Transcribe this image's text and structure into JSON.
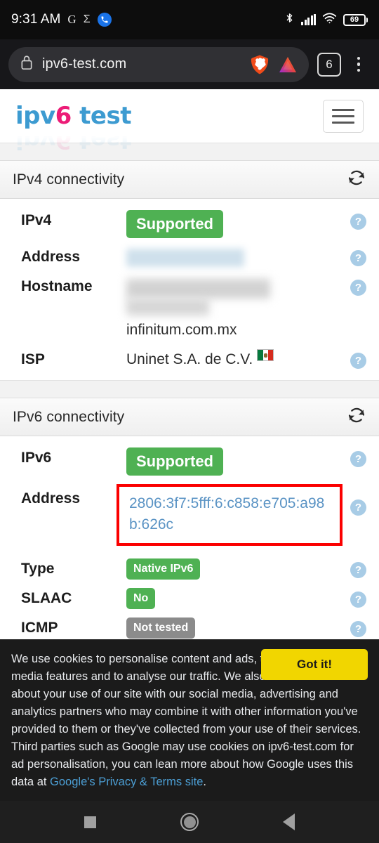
{
  "statusbar": {
    "time": "9:31 AM",
    "icons_left": [
      "google-g-icon",
      "sigma-icon",
      "phone-icon"
    ],
    "g_label": "G",
    "sigma_label": "Σ",
    "icons_right": [
      "bluetooth-icon",
      "cell-signal-icon",
      "wifi-icon",
      "battery-icon"
    ],
    "battery_percent": "69"
  },
  "browser": {
    "name": "Brave",
    "url": "ipv6-test.com",
    "lock_icon": "lock-icon",
    "shield_icon": "brave-lion-icon",
    "rewards_icon": "brave-triangle-icon",
    "tab_count": "6",
    "menu_icon": "kebab-menu-icon"
  },
  "site": {
    "logo_part1": "ipv",
    "logo_six": "6",
    "logo_part2": " test",
    "menu_button": "hamburger-menu"
  },
  "sections": [
    {
      "title": "IPv4 connectivity",
      "refresh_icon": "refresh-icon",
      "rows": [
        {
          "label": "IPv4",
          "kind": "badge",
          "badge_text": "Supported",
          "badge_color": "#4fb153",
          "badge_size": "big",
          "help": "?"
        },
        {
          "label": "Address",
          "kind": "redacted-blue",
          "help": "?"
        },
        {
          "label": "Hostname",
          "kind": "redacted-gray",
          "sub_text": "infinitum.com.mx",
          "help": "?"
        },
        {
          "label": "ISP",
          "kind": "text-flag",
          "value": "Uninet S.A. de C.V.",
          "flag": "mexico-flag",
          "help": "?"
        }
      ]
    },
    {
      "title": "IPv6 connectivity",
      "refresh_icon": "refresh-icon",
      "rows": [
        {
          "label": "IPv6",
          "kind": "badge",
          "badge_text": "Supported",
          "badge_color": "#4fb153",
          "badge_size": "big",
          "help": "?"
        },
        {
          "label": "Address",
          "kind": "link-highlighted",
          "value": "2806:3f7:5fff:6:c858:e705:a98b:626c",
          "highlight_color": "#fb0000",
          "help": "?"
        },
        {
          "label": "Type",
          "kind": "badge",
          "badge_text": "Native IPv6",
          "badge_color": "#4fb153",
          "badge_size": "sm",
          "help": "?"
        },
        {
          "label": "SLAAC",
          "kind": "badge",
          "badge_text": "No",
          "badge_color": "#4fb153",
          "badge_size": "sm",
          "help": "?"
        },
        {
          "label": "ICMP",
          "kind": "badge",
          "badge_text": "Not tested",
          "badge_color": "#8b8b8b",
          "badge_size": "sm",
          "help": "?"
        }
      ]
    }
  ],
  "cookie_banner": {
    "text_before_link": "We use cookies to personalise content and ads, to provide social media features and to analyse our traffic. We also share information about your use of our site with our social media, advertising and analytics partners who may combine it with other information you've provided to them or they've collected from your use of their services. Third parties such as Google may use cookies on ipv6-test.com for ad personalisation, you can lean more about how Google uses this data at ",
    "link_text": "Google's Privacy & Terms site",
    "text_after_link": ".",
    "accept_label": "Got it!",
    "accept_color": "#f1d600"
  },
  "navbar": {
    "recents": "recents-square-icon",
    "home": "home-circle-icon",
    "back": "back-triangle-icon"
  }
}
